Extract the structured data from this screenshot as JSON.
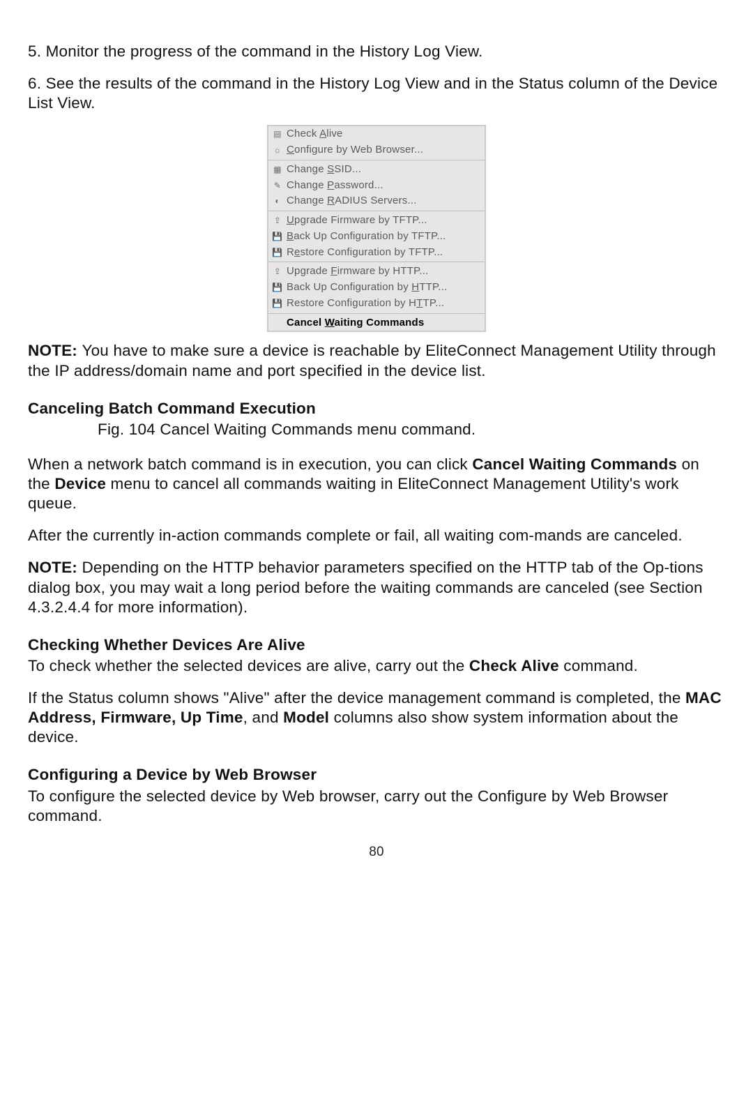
{
  "steps": {
    "s5": "5. Monitor the progress of the command in the History Log View.",
    "s6": "6. See the results of the command in the History Log View and in the Status column of the Device List View."
  },
  "menu": {
    "items": [
      {
        "icon": "doc-icon",
        "glyph": "▤",
        "label_pre": "Check ",
        "label_ul": "A",
        "label_post": "live"
      },
      {
        "icon": "web-icon",
        "glyph": "☼",
        "label_pre": "",
        "label_ul": "C",
        "label_post": "onfigure by Web Browser..."
      },
      "---",
      {
        "icon": "ssid-icon",
        "glyph": "▦",
        "label_pre": "Change ",
        "label_ul": "S",
        "label_post": "SID..."
      },
      {
        "icon": "key-icon",
        "glyph": "✎",
        "label_pre": "Change ",
        "label_ul": "P",
        "label_post": "assword..."
      },
      {
        "icon": "radius-icon",
        "glyph": "◐",
        "label_pre": "Change ",
        "label_ul": "R",
        "label_post": "ADIUS Servers..."
      },
      "---",
      {
        "icon": "upgrade-icon",
        "glyph": "⇪",
        "label_pre": "",
        "label_ul": "U",
        "label_post": "pgrade Firmware by TFTP..."
      },
      {
        "icon": "backup-icon",
        "glyph": "💾",
        "label_pre": "",
        "label_ul": "B",
        "label_post": "ack Up Configuration by TFTP..."
      },
      {
        "icon": "restore-icon",
        "glyph": "💾",
        "label_pre": "R",
        "label_ul": "e",
        "label_post": "store Configuration by TFTP..."
      },
      "---",
      {
        "icon": "upgrade-icon",
        "glyph": "⇪",
        "label_pre": "Upgrade ",
        "label_ul": "F",
        "label_post": "irmware by HTTP..."
      },
      {
        "icon": "backup-icon",
        "glyph": "💾",
        "label_pre": "Back Up Configuration by ",
        "label_ul": "H",
        "label_post": "TTP..."
      },
      {
        "icon": "restore-icon",
        "glyph": "💾",
        "label_pre": "Restore Configuration by H",
        "label_ul": "T",
        "label_post": "TP..."
      },
      "---",
      {
        "icon": "",
        "glyph": "",
        "strong": true,
        "label_pre": "Cancel ",
        "label_ul": "W",
        "label_post": "aiting Commands"
      }
    ]
  },
  "note1_bold": "NOTE: ",
  "note1_text": "You have to make sure a device is reachable by EliteConnect Management Utility through the IP address/domain name and port specified in the device list.",
  "section1_heading": "Canceling Batch Command Execution",
  "fig_caption": "Fig. 104 Cancel Waiting Commands menu command.",
  "cancel_para_pre": "When a network batch command is in execution, you can click ",
  "cancel_para_b1": "Cancel Waiting Commands",
  "cancel_para_mid": " on the ",
  "cancel_para_b2": "Device",
  "cancel_para_post": " menu to cancel all commands waiting in EliteConnect Management Utility's work queue.",
  "after_para": "After the currently in-action commands complete or fail, all waiting com-mands are canceled.",
  "note2_bold": "NOTE: ",
  "note2_text": "Depending on the HTTP behavior parameters specified on the HTTP tab of the Op-tions dialog box, you may wait a long period before the waiting commands are canceled (see Section 4.3.2.4.4 for more information).",
  "section2_heading": "Checking Whether Devices Are Alive",
  "check_pre": "To check whether the selected devices are alive, carry out the ",
  "check_b": "Check Alive",
  "check_post": " command.",
  "status_pre": "If the Status column shows \"Alive\" after the device management command is completed, the ",
  "status_b1": "MAC Address, Firmware, Up Time",
  "status_mid": ", and ",
  "status_b2": "Model",
  "status_post": " columns also show system information about the device.",
  "section3_heading": "Configuring a Device by Web Browser",
  "configure_para": "To configure the selected device by Web browser, carry out the Configure by Web Browser command.",
  "page_number": "80"
}
